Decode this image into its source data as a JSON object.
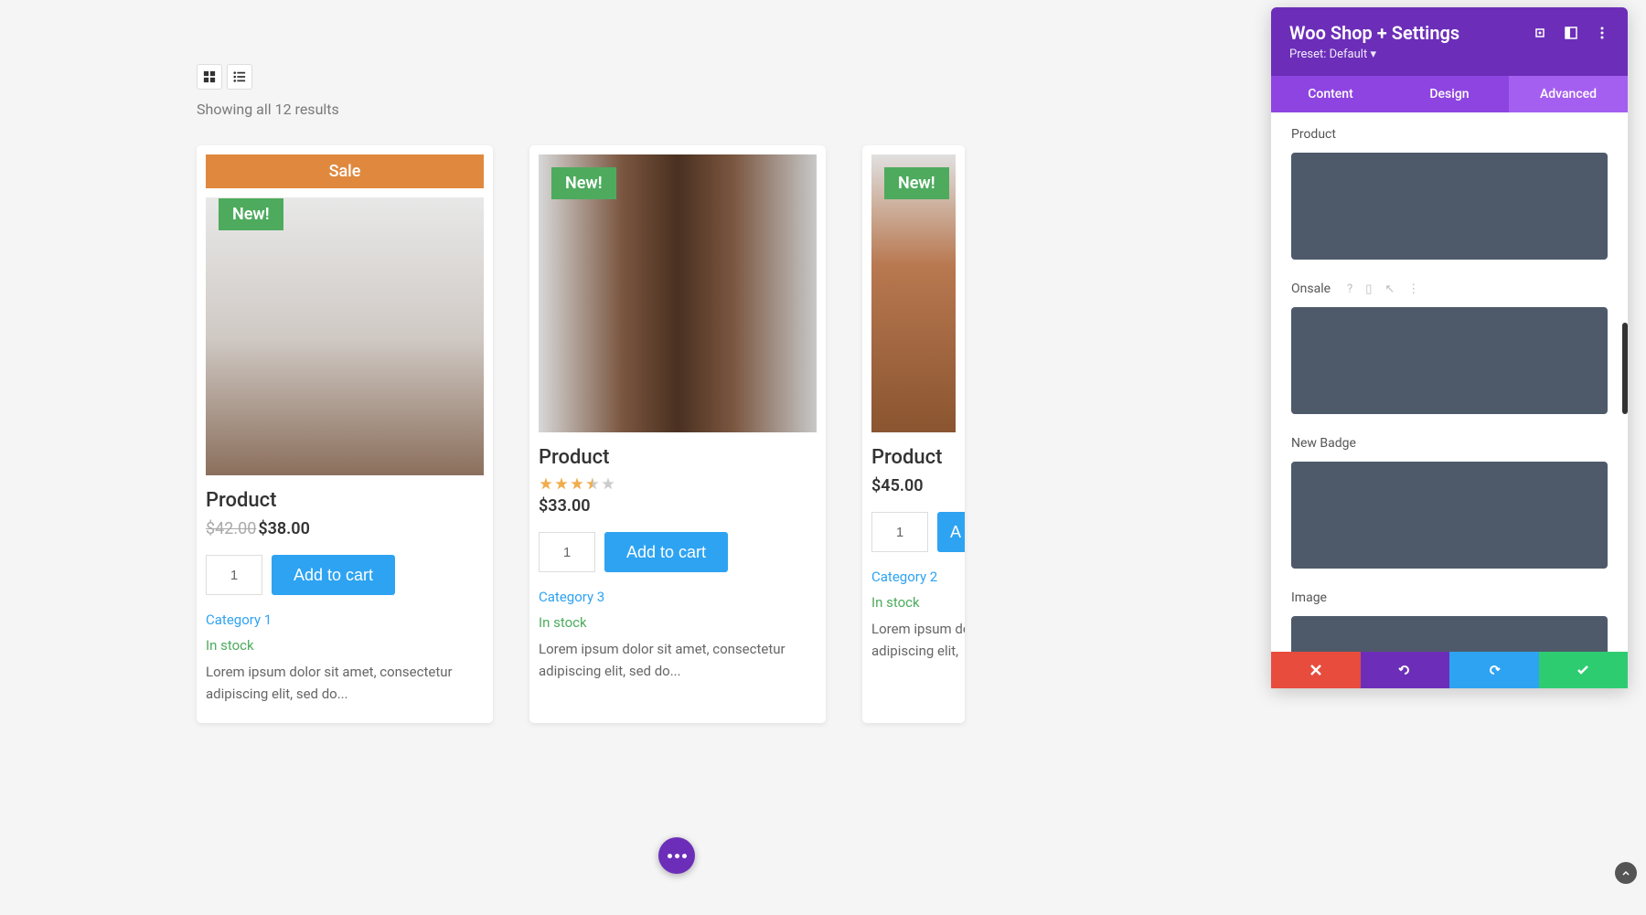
{
  "results_text": "Showing all 12 results",
  "sale_label": "Sale",
  "new_label": "New!",
  "products": [
    {
      "title": "Product",
      "has_sale": true,
      "old_price": "$42.00",
      "price": "$38.00",
      "qty": "1",
      "add_to_cart": "Add to cart",
      "category": "Category 1",
      "stock": "In stock",
      "description": "Lorem ipsum dolor sit amet, consectetur adipiscing elit, sed do..."
    },
    {
      "title": "Product",
      "has_sale": false,
      "rating": 3.5,
      "price": "$33.00",
      "qty": "1",
      "add_to_cart": "Add to cart",
      "category": "Category 3",
      "stock": "In stock",
      "description": "Lorem ipsum dolor sit amet, consectetur adipiscing elit, sed do..."
    },
    {
      "title": "Product",
      "has_sale": false,
      "price": "$45.00",
      "qty": "1",
      "add_to_cart": "A",
      "category": "Category 2",
      "stock": "In stock",
      "description": "Lorem ipsum dolor sit amet, consectetur adipiscing elit,"
    }
  ],
  "panel": {
    "title": "Woo Shop + Settings",
    "preset": "Preset: Default",
    "tabs": {
      "content": "Content",
      "design": "Design",
      "advanced": "Advanced"
    },
    "sections": {
      "product": "Product",
      "onsale": "Onsale",
      "new_badge": "New Badge",
      "image": "Image"
    }
  }
}
